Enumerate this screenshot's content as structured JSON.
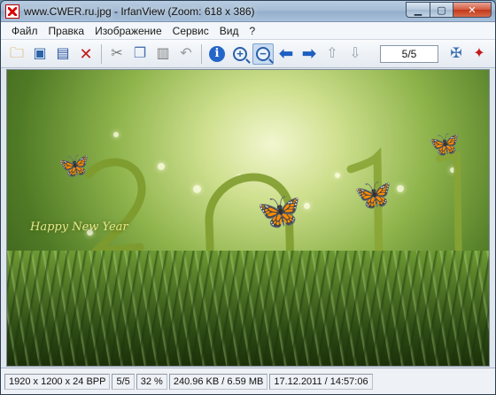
{
  "window": {
    "title": "www.CWER.ru.jpg - IrfanView (Zoom: 618 x 386)",
    "controls": {
      "minimize": "▁",
      "maximize": "▢",
      "close": "✕"
    }
  },
  "menu": [
    "Файл",
    "Правка",
    "Изображение",
    "Сервис",
    "Вид",
    "?"
  ],
  "toolbar": {
    "icons": {
      "open": "open-folder-icon",
      "thumbnails": "thumbnails-icon",
      "save": "save-icon",
      "delete": "delete-icon",
      "cut": "cut-icon",
      "copy": "copy-icon",
      "paste": "paste-icon",
      "undo": "undo-icon",
      "info": "info-icon",
      "zoom_in": "zoom-in-icon",
      "zoom_out": "zoom-out-icon",
      "prev": "previous-icon",
      "next": "next-icon",
      "first_page": "first-page-icon",
      "last_page": "last-page-icon",
      "properties": "properties-icon",
      "exit": "exit-icon"
    },
    "page_indicator": "5/5"
  },
  "image": {
    "greeting": "Happy New Year"
  },
  "status": {
    "dimensions": "1920 x 1200 x 24 BPP",
    "index": "5/5",
    "zoom": "32 %",
    "size": "240.96 KB / 6.59 MB",
    "datetime": "17.12.2011 / 14:57:06"
  }
}
